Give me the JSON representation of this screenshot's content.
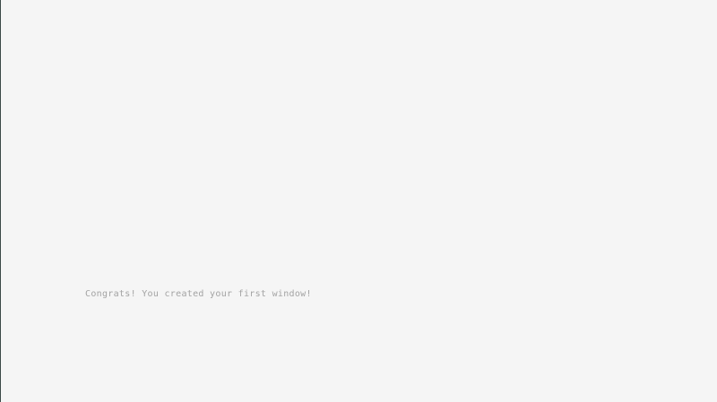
{
  "window": {
    "message": "Congrats! You created your first window!"
  },
  "colors": {
    "background": "#f5f5f5",
    "text": "#a3a3a3",
    "edge": "#3c4a48"
  }
}
